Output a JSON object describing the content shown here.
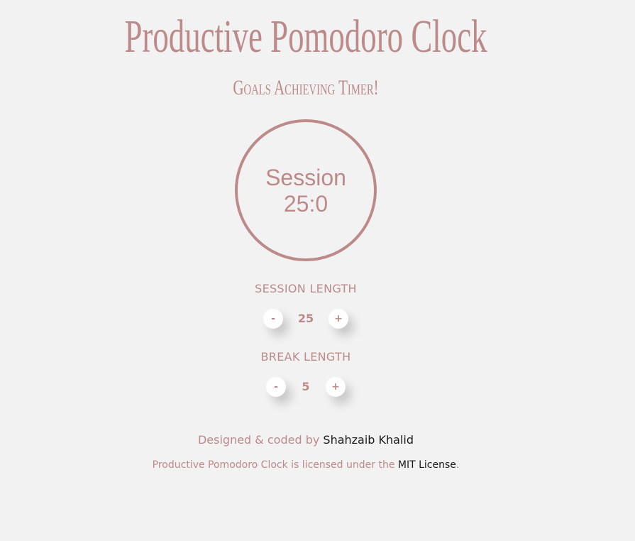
{
  "header": {
    "title": "Productive Pomodoro Clock",
    "subtitle": "Goals Achieving Timer!"
  },
  "clock": {
    "label": "Session",
    "time": "25:0"
  },
  "session": {
    "label": "SESSION LENGTH",
    "decrement": "-",
    "value": "25",
    "increment": "+"
  },
  "break": {
    "label": "BREAK LENGTH",
    "decrement": "-",
    "value": "5",
    "increment": "+"
  },
  "footer": {
    "credit_prefix": "Designed & coded by ",
    "author": "Shahzaib Khalid",
    "license_prefix": "Productive Pomodoro Clock is licensed under the ",
    "license_link": "MIT License",
    "license_suffix": "."
  },
  "colors": {
    "accent": "#bb8a89",
    "background": "#f2f2f2",
    "link": "#1a1a1a"
  }
}
